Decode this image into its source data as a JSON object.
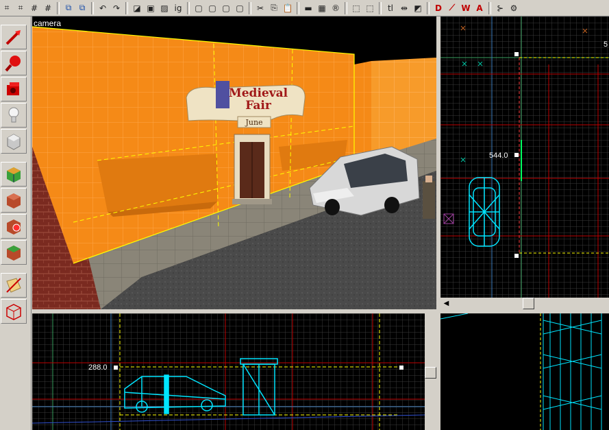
{
  "toolbar": {
    "buttons": [
      {
        "name": "grid-toggle-icon",
        "glyph": "⌗"
      },
      {
        "name": "grid-3d-icon",
        "glyph": "⌗"
      },
      {
        "name": "grid-smaller-icon",
        "glyph": "#"
      },
      {
        "name": "grid-larger-icon",
        "glyph": "#"
      },
      {
        "name": "copy-selection-icon",
        "glyph": "⧉"
      },
      {
        "name": "paste-special-icon",
        "glyph": "⧉"
      },
      {
        "name": "undo-icon",
        "glyph": "↶"
      },
      {
        "name": "redo-icon",
        "glyph": "↷"
      },
      {
        "name": "carve-icon",
        "glyph": "◪"
      },
      {
        "name": "group-icon",
        "glyph": "▣"
      },
      {
        "name": "ungroup-icon",
        "glyph": "▨"
      },
      {
        "name": "ignore-groups-label",
        "glyph": "ig"
      },
      {
        "name": "hide-selection-icon",
        "glyph": "▢"
      },
      {
        "name": "show-all-icon",
        "glyph": "▢"
      },
      {
        "name": "hollow-icon",
        "glyph": "▢"
      },
      {
        "name": "wireframe-icon",
        "glyph": "▢"
      },
      {
        "name": "cut-icon",
        "glyph": "✂"
      },
      {
        "name": "copy-icon",
        "glyph": "⎘"
      },
      {
        "name": "paste-icon",
        "glyph": "📋"
      },
      {
        "name": "texture-lock-icon",
        "glyph": "▬"
      },
      {
        "name": "texture-apply-icon",
        "glyph": "▦"
      },
      {
        "name": "replace-textures-icon",
        "glyph": "®"
      },
      {
        "name": "select-box-icon",
        "glyph": "⬚"
      },
      {
        "name": "select-dashed-icon",
        "glyph": "⬚"
      },
      {
        "name": "tl-label",
        "glyph": "tl"
      },
      {
        "name": "align-icon",
        "glyph": "⇹"
      },
      {
        "name": "flip-icon",
        "glyph": "◩"
      },
      {
        "name": "entity-report-icon",
        "glyph": "D"
      },
      {
        "name": "check-problems-icon",
        "glyph": "⟋"
      },
      {
        "name": "map-properties-icon",
        "glyph": "W"
      },
      {
        "name": "run-map-icon",
        "glyph": "A"
      },
      {
        "name": "transform-icon",
        "glyph": "⊱"
      },
      {
        "name": "options-icon",
        "glyph": "⚙"
      }
    ]
  },
  "left_tools": [
    {
      "name": "selection-tool-icon"
    },
    {
      "name": "magnify-tool-icon"
    },
    {
      "name": "camera-tool-icon"
    },
    {
      "name": "entity-tool-icon"
    },
    {
      "name": "block-tool-icon"
    },
    {
      "name": "texture-application-icon"
    },
    {
      "name": "apply-texture-icon"
    },
    {
      "name": "decal-tool-icon"
    },
    {
      "name": "overlay-tool-icon"
    },
    {
      "name": "clipping-tool-icon"
    },
    {
      "name": "vertex-tool-icon"
    }
  ],
  "camera_view": {
    "label": "camera",
    "sign": {
      "line1": "Medieval",
      "line2": "Fair",
      "line3": "June"
    }
  },
  "top_view": {
    "coord_left": "544.0",
    "coord_corner": "5"
  },
  "front_view": {
    "coord_left": "288.0"
  },
  "colors": {
    "brush_orange": "#f58a17",
    "wire_cyan": "#00e5ff",
    "grid_red": "#c00000",
    "selection_yellow": "#ffff00"
  }
}
